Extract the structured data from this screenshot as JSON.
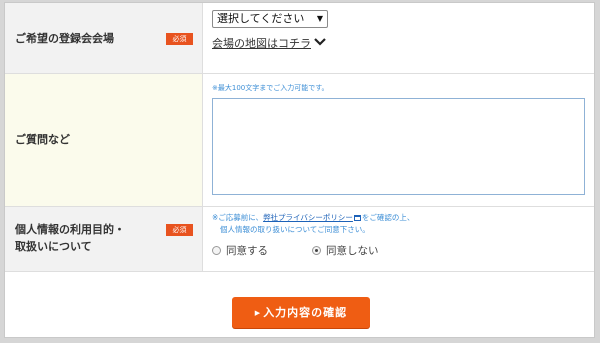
{
  "venue_row": {
    "label": "ご希望の登録会会場",
    "required": "必須",
    "select_value": "選択してください",
    "map_link": "会場の地図はコチラ",
    "map_link_icon": "chevron-down-icon"
  },
  "question_row": {
    "label": "ご質問など",
    "hint": "※最大100文字までご入力可能です。",
    "textarea_value": ""
  },
  "privacy_row": {
    "label_line1": "個人情報の利用目的・",
    "label_line2": "取扱いについて",
    "required": "必須",
    "note_prefix": "※ご応募前に、",
    "note_link": "弊社プライバシーポリシー",
    "note_link_icon": "external-window-icon",
    "note_suffix": "をご確認の上、",
    "note_line2": "個人情報の取り扱いについてご同意下さい。",
    "options": [
      {
        "label": "同意する",
        "checked": false
      },
      {
        "label": "同意しない",
        "checked": true
      }
    ]
  },
  "footer": {
    "submit_label": "入力内容の確認",
    "submit_icon": "arrow-right-icon"
  },
  "colors": {
    "accent": "#ef5d13",
    "badge": "#e8531f",
    "hint": "#3e8fd6",
    "link": "#1d62b8"
  }
}
